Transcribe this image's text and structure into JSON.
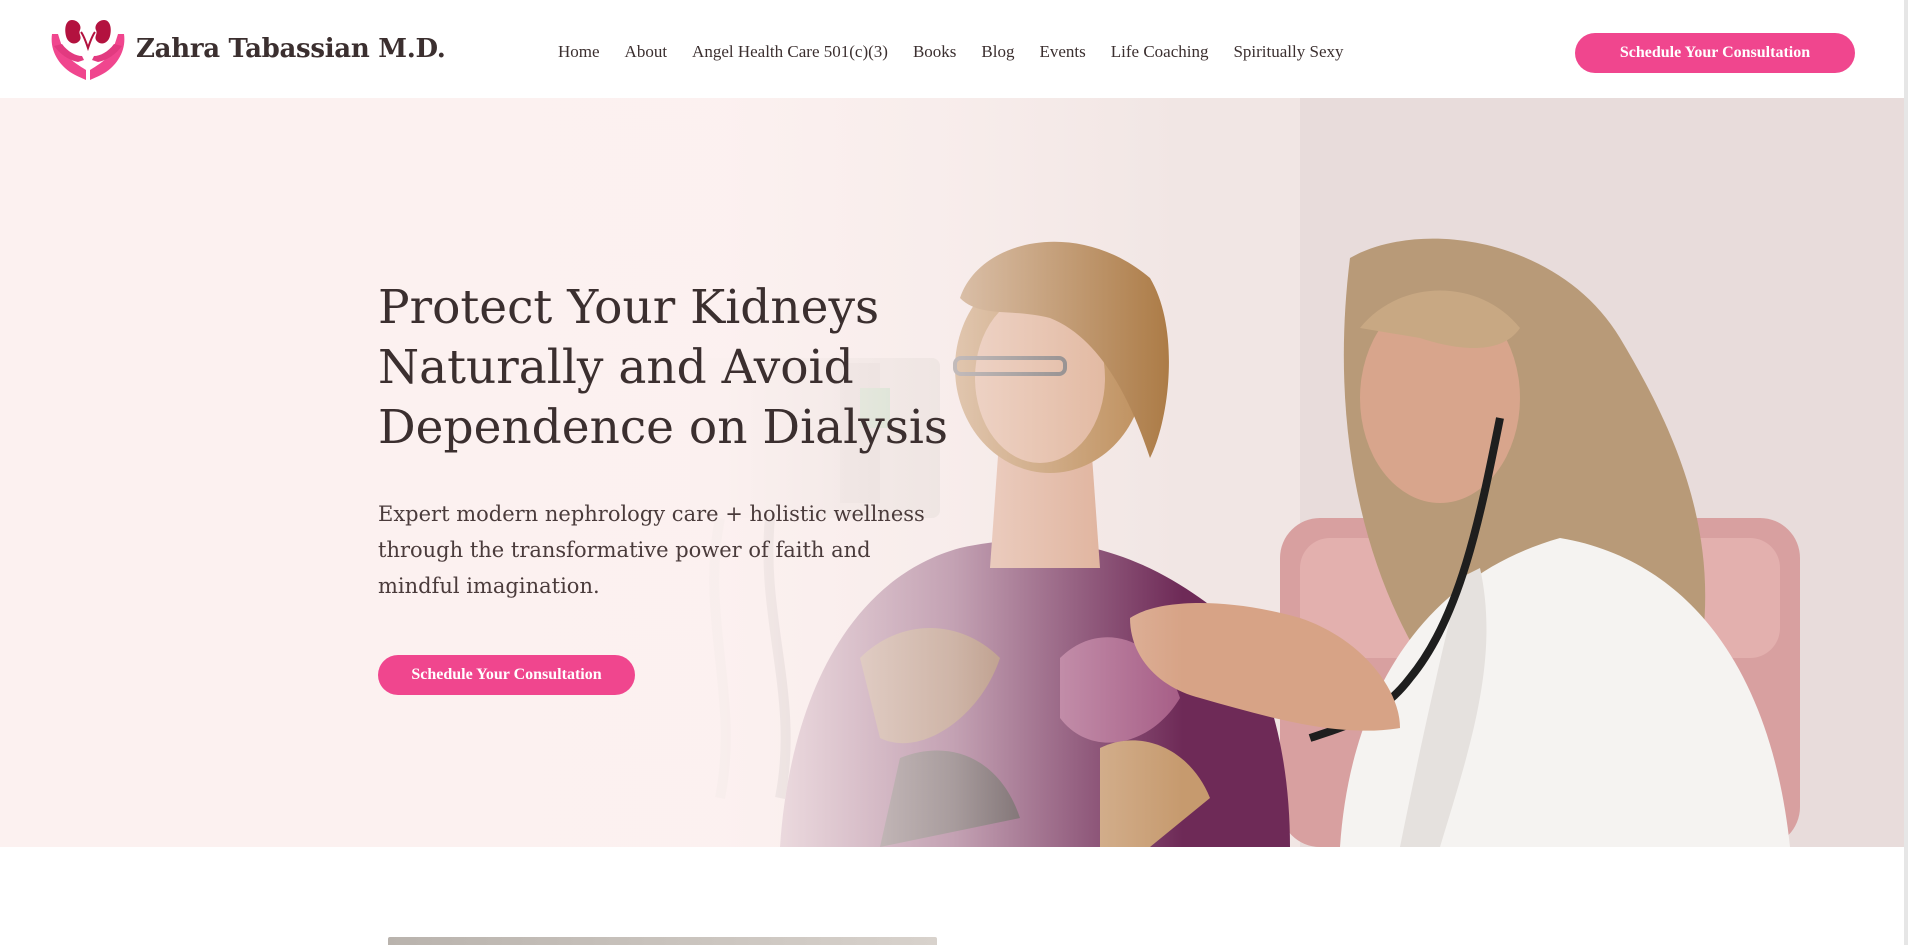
{
  "brand": {
    "name": "Zahra Tabassian M.D.",
    "logo_icon": "kidneys-in-hands-icon",
    "accent_color": "#f0468e",
    "logo_dark_color": "#b3123f"
  },
  "nav": {
    "items": [
      {
        "label": "Home"
      },
      {
        "label": "About"
      },
      {
        "label": "Angel Health Care 501(c)(3)"
      },
      {
        "label": "Books"
      },
      {
        "label": "Blog"
      },
      {
        "label": "Events"
      },
      {
        "label": "Life Coaching"
      },
      {
        "label": "Spiritually Sexy"
      }
    ],
    "cta_label": "Schedule Your Consultation"
  },
  "hero": {
    "heading": "Protect Your Kidneys Naturally and Avoid Dependence on Dialysis",
    "subheading": "Expert modern nephrology care + holistic wellness through the transformative power of faith and mindful imagination.",
    "cta_label": "Schedule Your Consultation",
    "image_icon": "doctor-patient-photo"
  }
}
